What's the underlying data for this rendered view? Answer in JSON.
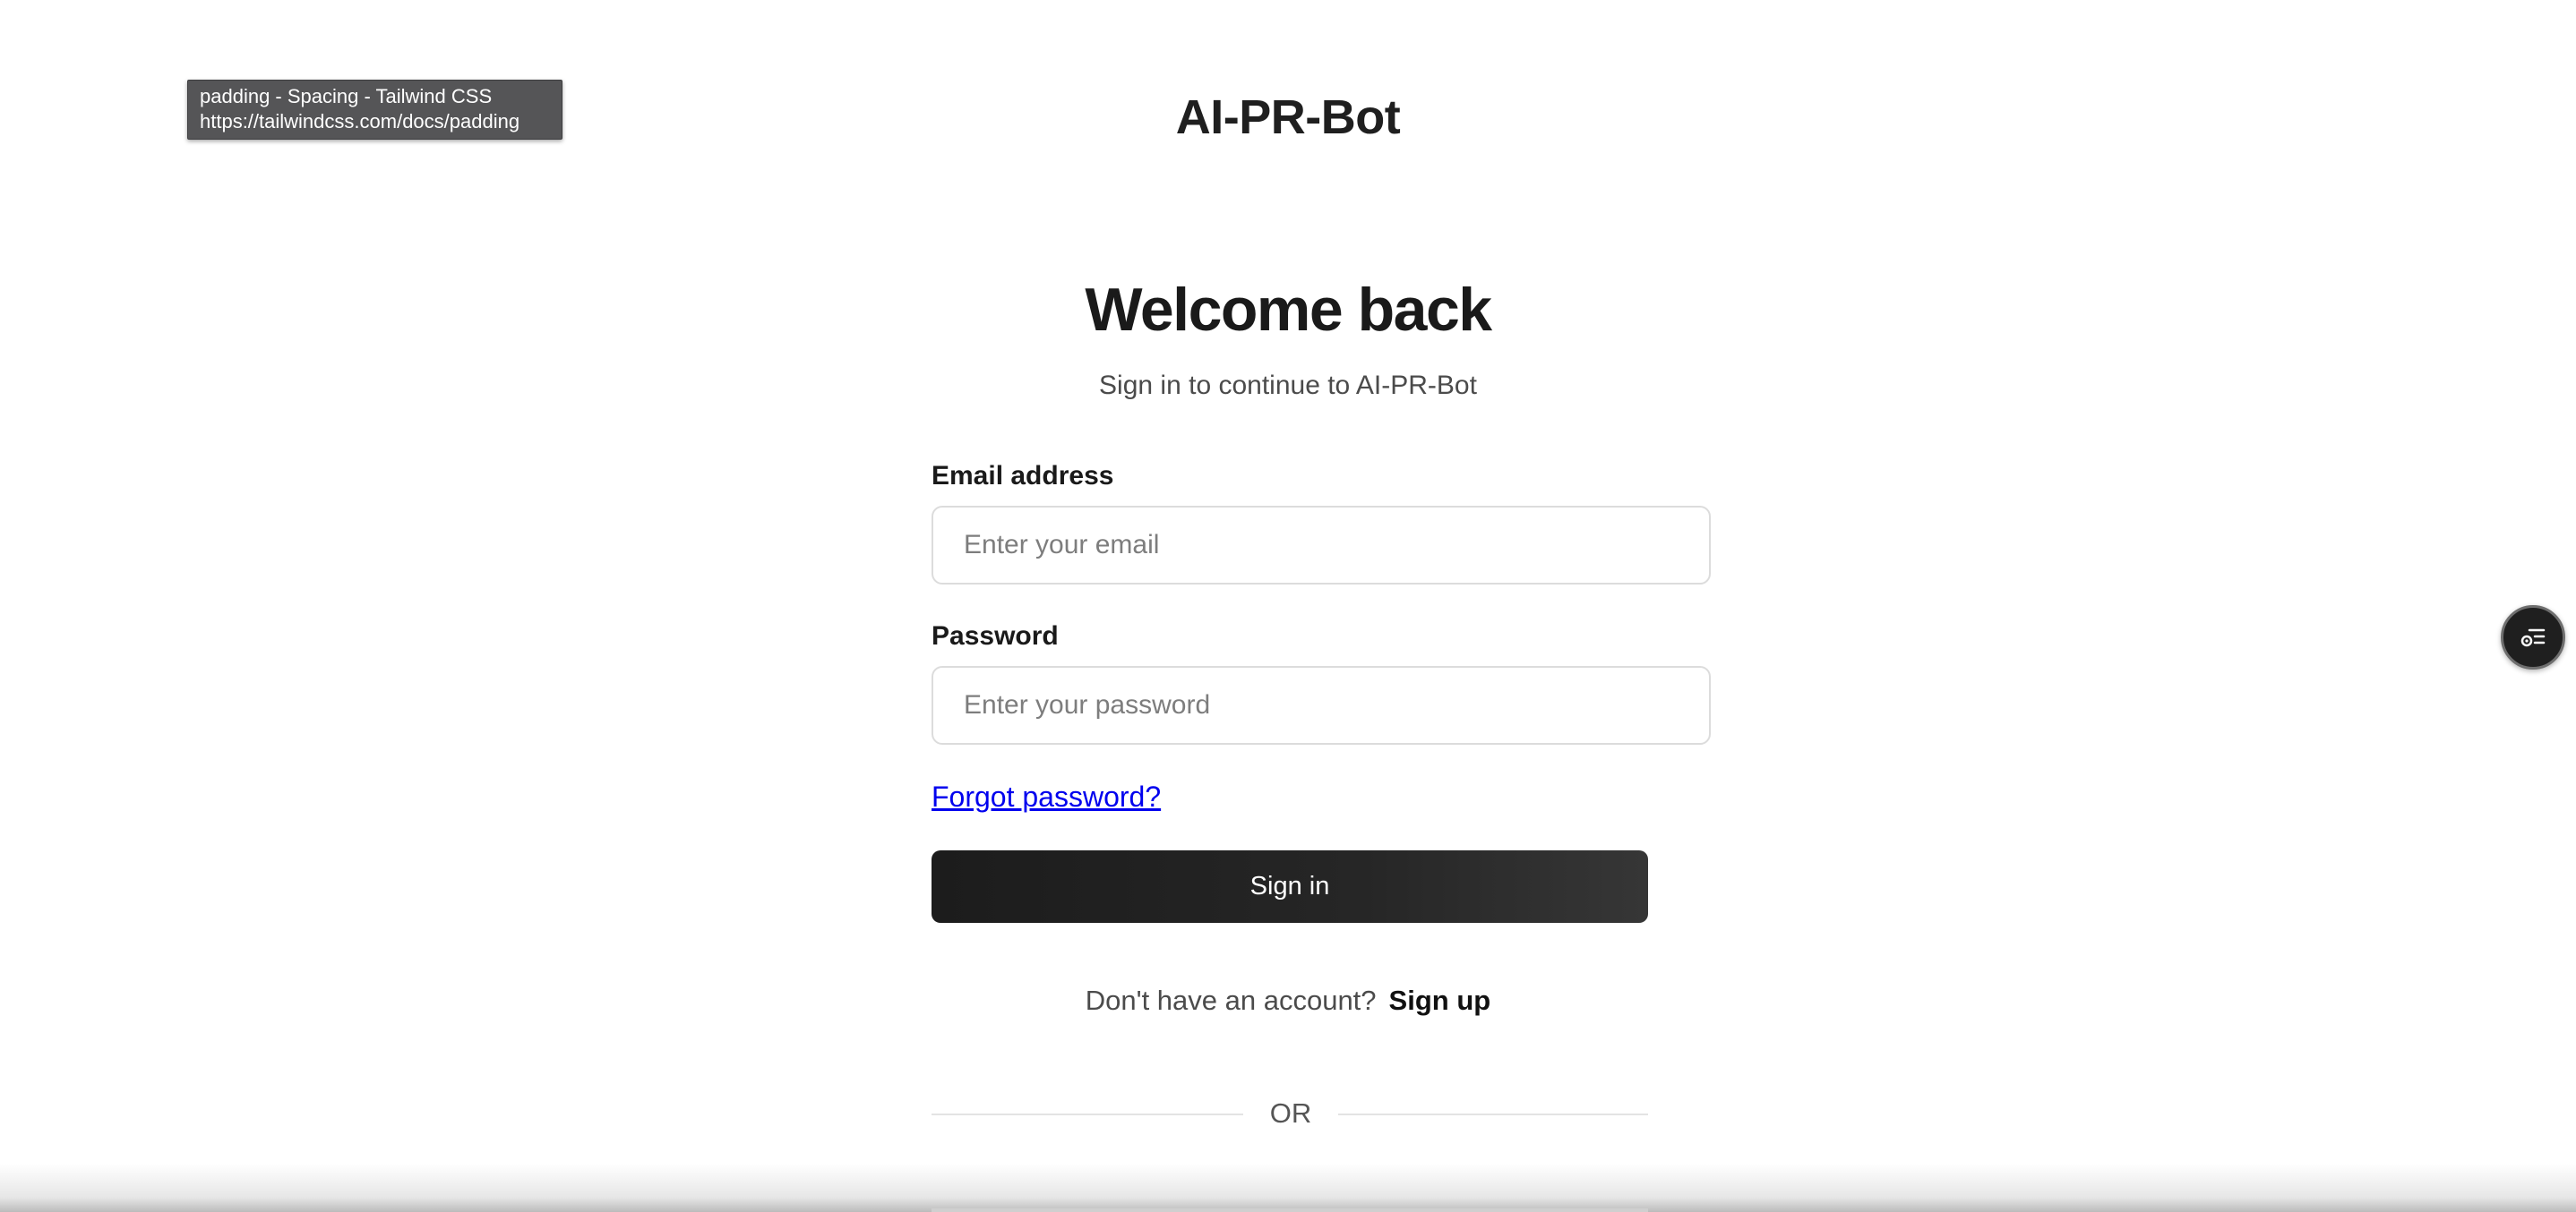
{
  "tooltip": {
    "title": "padding - Spacing - Tailwind CSS",
    "url": "https://tailwindcss.com/docs/padding"
  },
  "header": {
    "brand": "AI-PR-Bot"
  },
  "login": {
    "title": "Welcome back",
    "subtitle": "Sign in to continue to AI-PR-Bot",
    "email_label": "Email address",
    "email_placeholder": "Enter your email",
    "email_value": "",
    "password_label": "Password",
    "password_placeholder": "Enter your password",
    "password_value": "",
    "forgot_link": "Forgot password?",
    "submit_label": "Sign in",
    "signup_prompt": "Don't have an account?",
    "signup_link": "Sign up",
    "divider_text": "OR"
  },
  "floating_widget": {
    "icon": "list-settings-icon"
  },
  "colors": {
    "button_bg": "#1c1c1c",
    "link": "#0000ee",
    "text_primary": "#1a1a1a",
    "text_muted": "#4b4b4b"
  }
}
